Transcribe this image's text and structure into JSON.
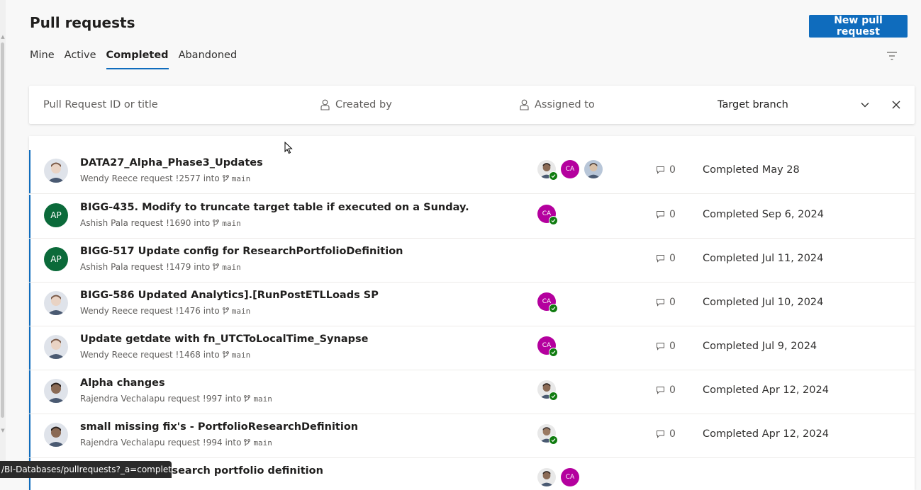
{
  "page": {
    "title": "Pull requests"
  },
  "actions": {
    "new_pr_label": "New pull request"
  },
  "tabs": [
    {
      "label": "Mine",
      "selected": false
    },
    {
      "label": "Active",
      "selected": false
    },
    {
      "label": "Completed",
      "selected": true
    },
    {
      "label": "Abandoned",
      "selected": false
    }
  ],
  "filters": {
    "search_placeholder": "Pull Request ID or title",
    "created_by": "Created by",
    "assigned_to": "Assigned to",
    "target_branch": "Target branch"
  },
  "pull_requests": [
    {
      "title": "DATA27_Alpha_Phase3_Updates",
      "author": "Wendy Reece",
      "id": "!2577",
      "branch": "main",
      "comments": "0",
      "status": "Completed May 28"
    },
    {
      "title": "BIGG-435. Modify to truncate target table if executed on a Sunday.",
      "author": "Ashish Pala",
      "id": "!1690",
      "branch": "main",
      "comments": "0",
      "status": "Completed Sep 6, 2024",
      "avatar_initials": "AP"
    },
    {
      "title": "BIGG-517 Update config for ResearchPortfolioDefinition",
      "author": "Ashish Pala",
      "id": "!1479",
      "branch": "main",
      "comments": "0",
      "status": "Completed Jul 11, 2024",
      "avatar_initials": "AP"
    },
    {
      "title": "BIGG-586 Updated Analytics].[RunPostETLLoads SP",
      "author": "Wendy Reece",
      "id": "!1476",
      "branch": "main",
      "comments": "0",
      "status": "Completed Jul 10, 2024"
    },
    {
      "title": "Update getdate with fn_UTCToLocalTime_Synapse",
      "author": "Wendy Reece",
      "id": "!1468",
      "branch": "main",
      "comments": "0",
      "status": "Completed Jul 9, 2024"
    },
    {
      "title": "Alpha changes",
      "author": "Rajendra Vechalapu",
      "id": "!997",
      "branch": "main",
      "comments": "0",
      "status": "Completed Apr 12, 2024"
    },
    {
      "title": "small missing fix's - PortfolioResearchDefinition",
      "author": "Rajendra Vechalapu",
      "id": "!994",
      "branch": "main",
      "comments": "0",
      "status": "Completed Apr 12, 2024"
    },
    {
      "title": "ies changes - research portfolio definition",
      "author": "",
      "id": "",
      "branch": "",
      "comments": "",
      "status": ""
    }
  ],
  "common": {
    "request_word": "request",
    "into_word": "into",
    "reviewer_initials": "CA"
  },
  "status_bar": {
    "url": "/BI-Databases/pullrequests?_a=completed"
  }
}
